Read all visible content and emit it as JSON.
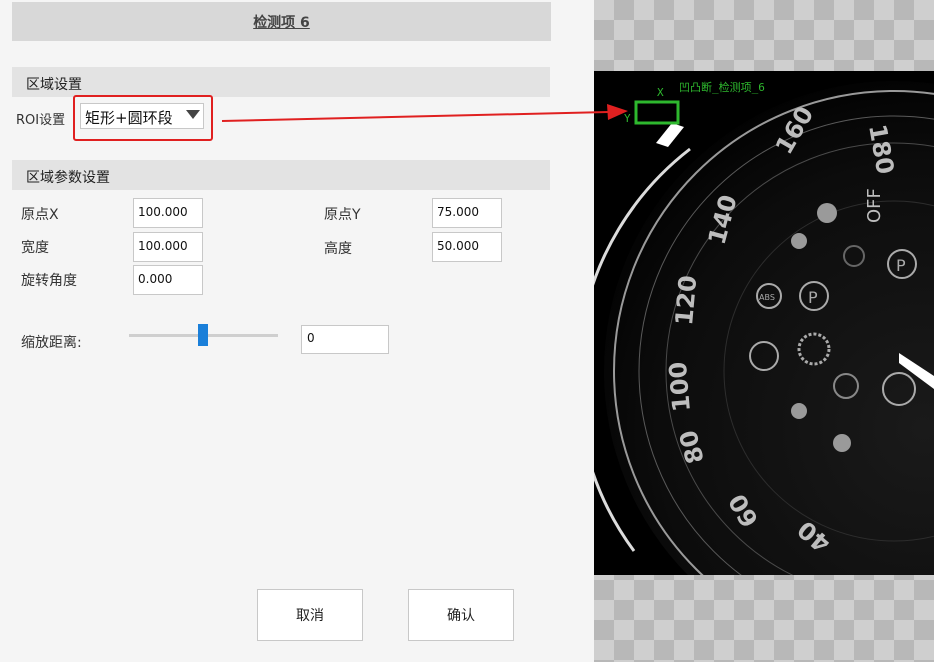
{
  "header": {
    "title": "检测项 6"
  },
  "region": {
    "section_title": "区域设置",
    "roi_label": "ROI设置",
    "roi_value": "矩形+圆环段"
  },
  "params": {
    "section_title": "区域参数设置",
    "origin_x_label": "原点X",
    "origin_x_value": "100.000",
    "origin_y_label": "原点Y",
    "origin_y_value": "75.000",
    "width_label": "宽度",
    "width_value": "100.000",
    "height_label": "高度",
    "height_value": "50.000",
    "rotation_label": "旋转角度",
    "rotation_value": "0.000"
  },
  "zoom": {
    "label": "缩放距离:",
    "value": "0",
    "slider_position": 0.47
  },
  "buttons": {
    "cancel": "取消",
    "confirm": "确认"
  },
  "preview": {
    "overlay_text": "凹凸断_检测项_6",
    "axis_x": "X",
    "axis_y": "Y",
    "dial_numbers": [
      "180",
      "160",
      "140",
      "120",
      "100",
      "80",
      "60",
      "40"
    ],
    "off_label": "OFF",
    "p_label": "P",
    "abs_label": "ABS",
    "overlay_color": "#2eb82e",
    "arrow_color": "#e02020"
  }
}
